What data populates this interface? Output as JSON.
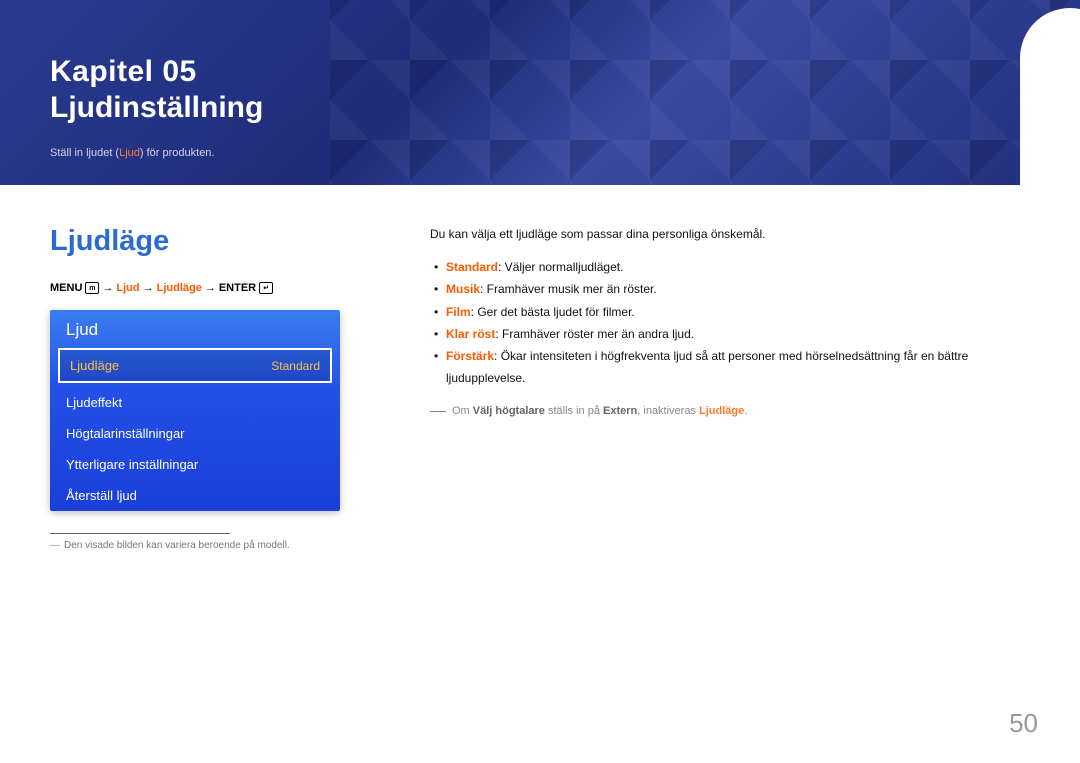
{
  "header": {
    "chapter_label": "Kapitel 05",
    "chapter_title": "Ljudinställning",
    "subtitle_pre": "Ställ in ljudet (",
    "subtitle_accent": "Ljud",
    "subtitle_post": ") för produkten."
  },
  "section": {
    "title": "Ljudläge"
  },
  "menu_path": {
    "p1": "MENU",
    "icon1": "m",
    "arrow": "→",
    "p2": "Ljud",
    "p3": "Ljudläge",
    "p4": "ENTER",
    "icon2": "↵"
  },
  "osd": {
    "title": "Ljud",
    "items": [
      {
        "label": "Ljudläge",
        "value": "Standard",
        "selected": true
      },
      {
        "label": "Ljudeffekt",
        "value": "",
        "selected": false
      },
      {
        "label": "Högtalarinställningar",
        "value": "",
        "selected": false
      },
      {
        "label": "Ytterligare inställningar",
        "value": "",
        "selected": false
      },
      {
        "label": "Återställ ljud",
        "value": "",
        "selected": false
      }
    ]
  },
  "footnote": {
    "dash": "―",
    "text": "Den visade bilden kan variera beroende på modell."
  },
  "description": {
    "intro": "Du kan välja ett ljudläge som passar dina personliga önskemål.",
    "bullets": [
      {
        "term": "Standard",
        "text": ": Väljer normalljudläget."
      },
      {
        "term": "Musik",
        "text": ": Framhäver musik mer än röster."
      },
      {
        "term": "Film",
        "text": ": Ger det bästa ljudet för filmer."
      },
      {
        "term": "Klar röst",
        "text": ": Framhäver röster mer än andra ljud."
      },
      {
        "term": "Förstärk",
        "text": ": Ökar intensiteten i högfrekventa ljud så att personer med hörselnedsättning får en bättre ljudupplevelse."
      }
    ],
    "note_pre": "Om ",
    "note_b1": "Välj högtalare",
    "note_mid": " ställs in på ",
    "note_b2": "Extern",
    "note_mid2": ", inaktiveras ",
    "note_term": "Ljudläge",
    "note_post": "."
  },
  "page_number": "50"
}
